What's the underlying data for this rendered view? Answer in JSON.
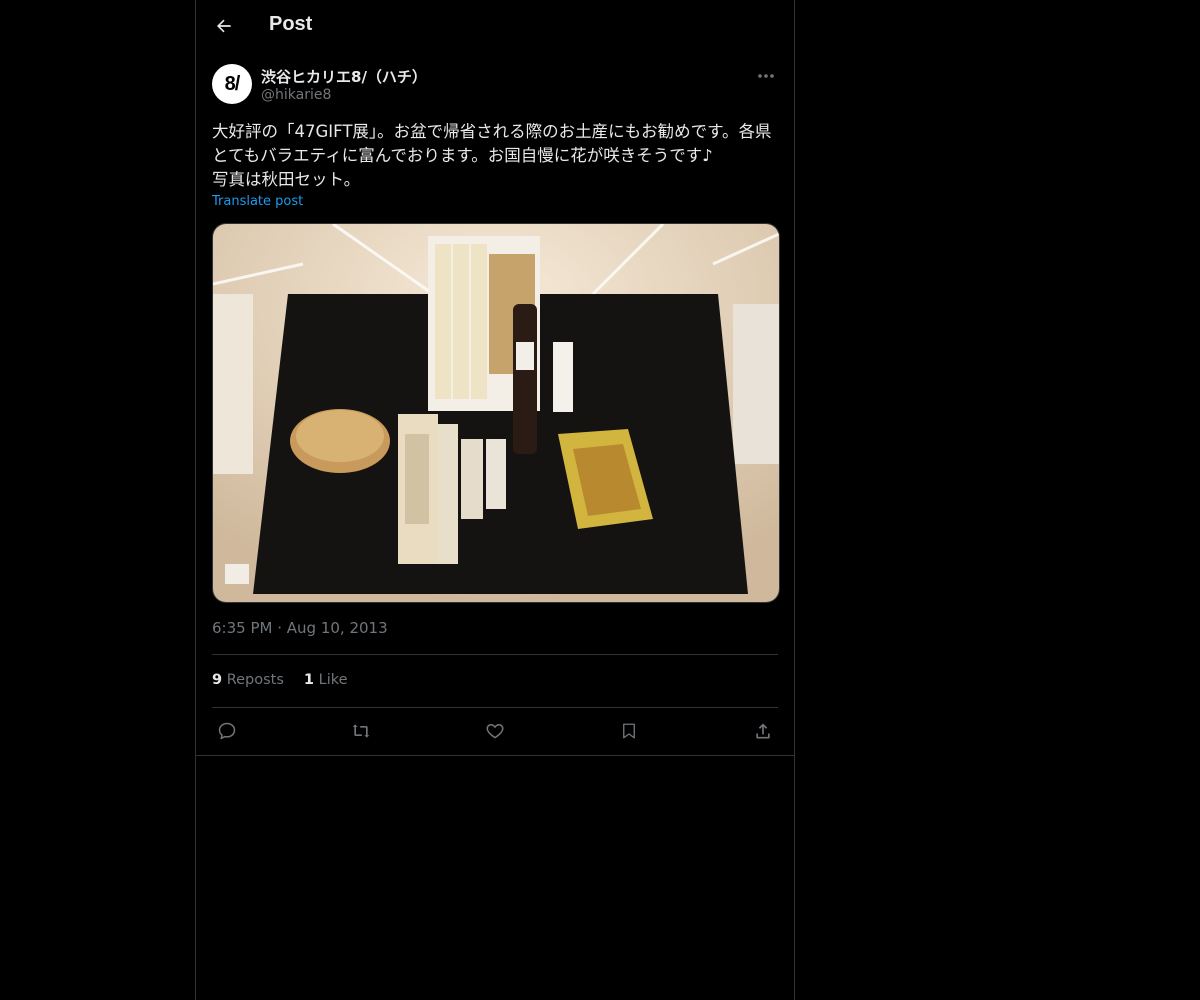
{
  "header": {
    "title": "Post"
  },
  "author": {
    "display_name": "渋谷ヒカリエ8/（ハチ）",
    "handle": "@hikarie8",
    "avatar_text": "8/"
  },
  "tweet": {
    "text": "大好評の「47GIFT展」。お盆で帰省される際のお土産にもお勧めです。各県とてもバラエティに富んでおります。お国自慢に花が咲きそうです♪\n写真は秋田セット。",
    "translate_label": "Translate post",
    "time": "6:35 PM",
    "separator": " · ",
    "date": "Aug 10, 2013"
  },
  "stats": {
    "reposts_count": "9",
    "reposts_label": "Reposts",
    "likes_count": "1",
    "likes_label": "Like"
  },
  "icons": {
    "back": "arrow-left-icon",
    "more": "more-horizontal-icon",
    "reply": "reply-icon",
    "repost": "repost-icon",
    "like": "heart-icon",
    "bookmark": "bookmark-icon",
    "share": "share-icon"
  },
  "colors": {
    "background": "#000000",
    "text": "#e7e9ea",
    "muted": "#71767b",
    "link": "#1d9bf0",
    "border": "#2f3336"
  }
}
